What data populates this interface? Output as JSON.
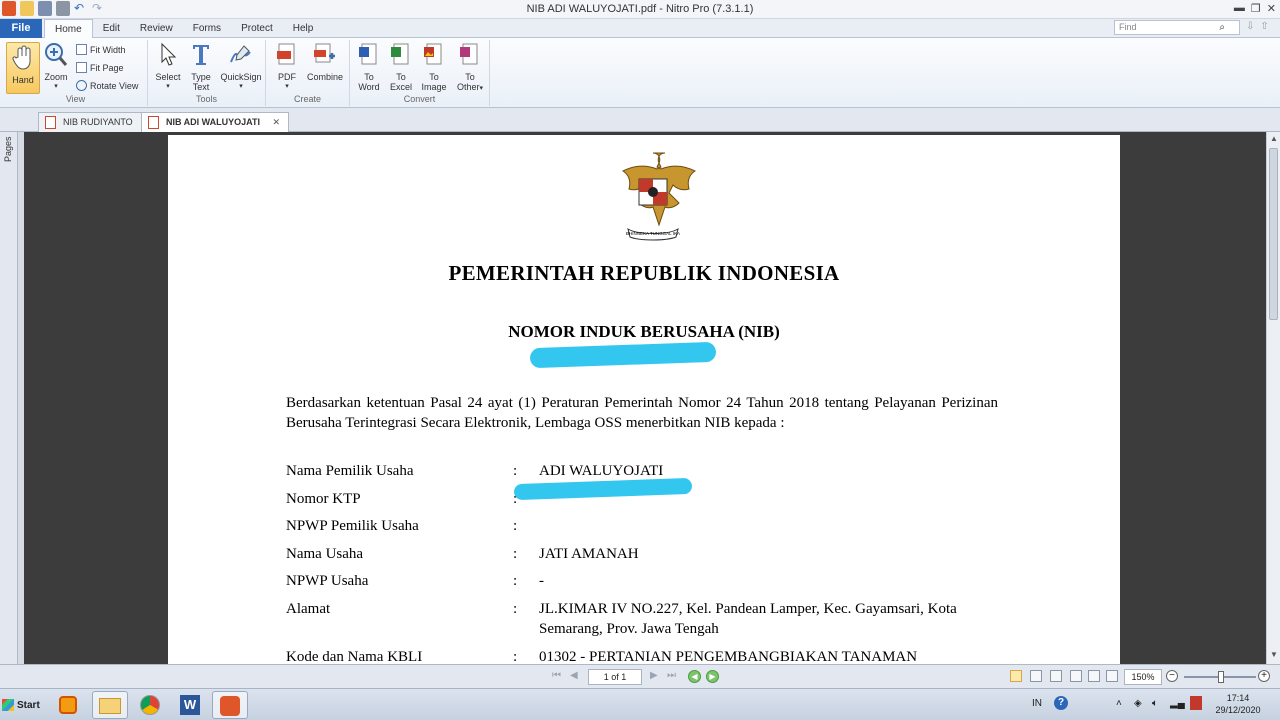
{
  "app": {
    "window_title": "NIB ADI WALUYOJATI.pdf - Nitro Pro (7.3.1.1)"
  },
  "menu": {
    "file": "File",
    "tabs": [
      "Home",
      "Edit",
      "Review",
      "Forms",
      "Protect",
      "Help"
    ],
    "find_placeholder": "Find"
  },
  "ribbon": {
    "view": {
      "label": "View",
      "hand": "Hand",
      "zoom": "Zoom",
      "fit_width": "Fit Width",
      "fit_page": "Fit Page",
      "rotate_view": "Rotate View"
    },
    "tools": {
      "label": "Tools",
      "select": "Select",
      "type_text_1": "Type",
      "type_text_2": "Text",
      "quicksign": "QuickSign"
    },
    "create": {
      "label": "Create",
      "pdf": "PDF",
      "combine": "Combine"
    },
    "convert": {
      "label": "Convert",
      "to": "To",
      "word": "Word",
      "excel": "Excel",
      "image": "Image",
      "other": "Other"
    }
  },
  "doc_tabs": [
    {
      "label": "NIB RUDIYANTO",
      "active": false
    },
    {
      "label": "NIB ADI WALUYOJATI",
      "active": true
    }
  ],
  "sidebar": {
    "pages_label": "Pages"
  },
  "document": {
    "emblem_motto": "BHINNEKA TUNGGAL IKA",
    "heading": "PEMERINTAH REPUBLIK INDONESIA",
    "subheading": "NOMOR INDUK BERUSAHA (NIB)",
    "intro": "Berdasarkan ketentuan Pasal 24 ayat (1) Peraturan Pemerintah Nomor 24 Tahun 2018 tentang Pelayanan Perizinan Berusaha Terintegrasi Secara Elektronik, Lembaga OSS menerbitkan NIB kepada :",
    "fields": [
      {
        "label": "Nama Pemilik Usaha",
        "value": "ADI WALUYOJATI"
      },
      {
        "label": "Nomor KTP",
        "value": ""
      },
      {
        "label": "NPWP Pemilik Usaha",
        "value": ""
      },
      {
        "label": "Nama Usaha",
        "value": "JATI AMANAH"
      },
      {
        "label": "NPWP Usaha",
        "value": "-"
      },
      {
        "label": "Alamat",
        "value": "JL.KIMAR IV NO.227, Kel. Pandean Lamper, Kec. Gayamsari, Kota Semarang, Prov. Jawa Tengah"
      },
      {
        "label": "Kode dan Nama KBLI",
        "value": "01302 - PERTANIAN PENGEMBANGBIAKAN TANAMAN"
      }
    ],
    "colon": ":"
  },
  "statusbar": {
    "page_indicator": "1 of 1",
    "zoom": "150%"
  },
  "taskbar": {
    "start": "Start",
    "lang": "IN",
    "time": "17:14",
    "date": "29/12/2020"
  },
  "colors": {
    "accent": "#2b67b8",
    "redaction": "#33c6ee",
    "viewer_bg": "#3c3c3c"
  }
}
